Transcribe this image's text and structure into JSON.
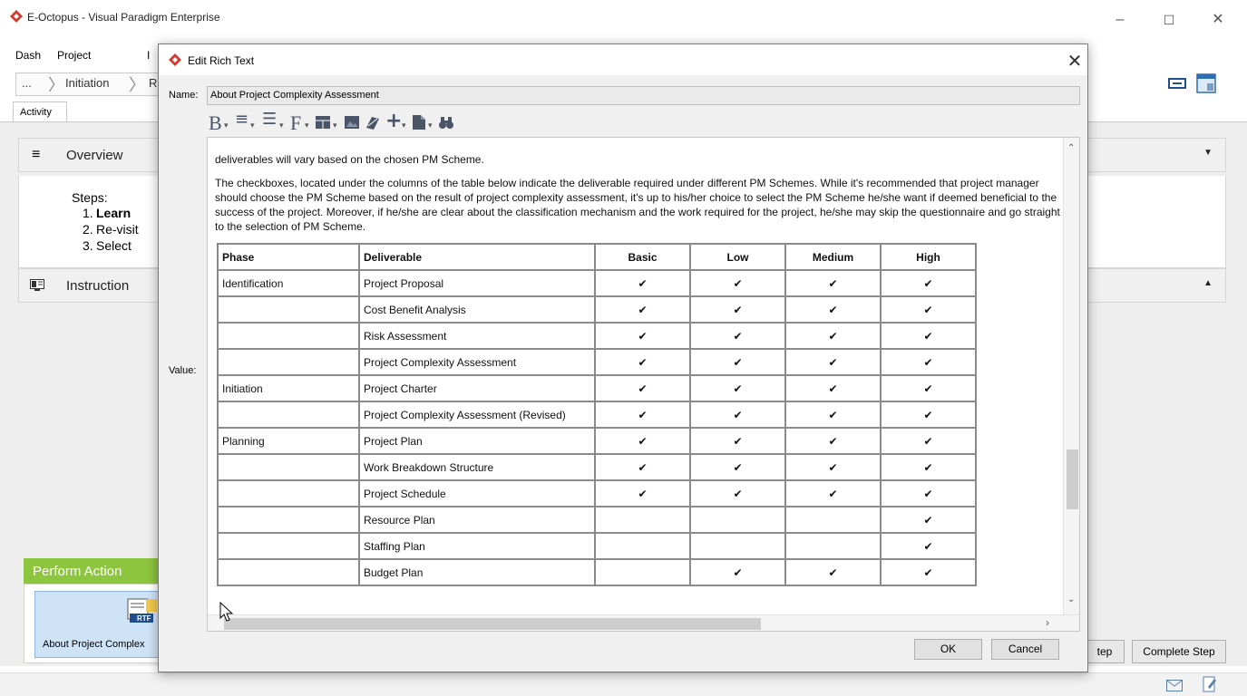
{
  "window": {
    "title": "E-Octopus - Visual Paradigm Enterprise",
    "controls": {
      "minimize": "–",
      "maximize": "☐",
      "close": "✕"
    }
  },
  "menu": [
    "Dash",
    "Project",
    "I"
  ],
  "breadcrumb": {
    "ellipsis": "...",
    "item1": "Initiation",
    "item2": "R"
  },
  "tabs": {
    "activity": "Activity"
  },
  "panels": {
    "overview": "Overview",
    "instruction": "Instruction",
    "steps_label": "Steps:",
    "steps": [
      {
        "num": "1.",
        "text": "Learn"
      },
      {
        "num": "2.",
        "text": "Re-visit"
      },
      {
        "num": "3.",
        "text": "Select"
      }
    ]
  },
  "perform_action": {
    "header": "Perform Action",
    "tile_label": "About Project Complex",
    "tile_icon_text": "RTF"
  },
  "bottom_buttons": {
    "step": "tep",
    "complete": "Complete Step"
  },
  "dialog": {
    "title": "Edit Rich Text",
    "close": "✕",
    "name_label": "Name:",
    "name_value": "About Project Complexity Assessment",
    "value_label": "Value:",
    "toolbar": {
      "bold": "B",
      "align": "≡",
      "list": "☰",
      "font": "F",
      "plus": "+",
      "find": "⛼"
    },
    "paragraphs": [
      "deliverables will vary based on the chosen PM Scheme.",
      "The checkboxes, located under the columns of the table below indicate the deliverable required under different PM Schemes. While it's recommended that project manager should choose the PM Scheme based on the result of project complexity assessment, it's up to his/her choice to select the PM Scheme he/she want if deemed beneficial to the success of the project. Moreover, if he/she are clear about the classification mechanism and the work required for the project, he/she may skip the questionnaire and go straight to the selection of PM Scheme."
    ],
    "table": {
      "headers": [
        "Phase",
        "Deliverable",
        "Basic",
        "Low",
        "Medium",
        "High"
      ],
      "check_glyph": "✔",
      "rows": [
        {
          "phase": "Identification",
          "deliverable": "Project Proposal",
          "basic": "✔",
          "low": "✔",
          "medium": "✔",
          "high": "✔"
        },
        {
          "phase": "",
          "deliverable": "Cost Benefit Analysis",
          "basic": "✔",
          "low": "✔",
          "medium": "✔",
          "high": "✔"
        },
        {
          "phase": "",
          "deliverable": "Risk Assessment",
          "basic": "✔",
          "low": "✔",
          "medium": "✔",
          "high": "✔"
        },
        {
          "phase": "",
          "deliverable": "Project Complexity Assessment",
          "basic": "✔",
          "low": "✔",
          "medium": "✔",
          "high": "✔"
        },
        {
          "phase": "Initiation",
          "deliverable": "Project Charter",
          "basic": "✔",
          "low": "✔",
          "medium": "✔",
          "high": "✔"
        },
        {
          "phase": "",
          "deliverable": "Project Complexity Assessment (Revised)",
          "basic": "✔",
          "low": "✔",
          "medium": "✔",
          "high": "✔"
        },
        {
          "phase": "Planning",
          "deliverable": "Project Plan",
          "basic": "✔",
          "low": "✔",
          "medium": "✔",
          "high": "✔"
        },
        {
          "phase": "",
          "deliverable": "Work Breakdown Structure",
          "basic": "✔",
          "low": "✔",
          "medium": "✔",
          "high": "✔"
        },
        {
          "phase": "",
          "deliverable": "Project Schedule",
          "basic": "✔",
          "low": "✔",
          "medium": "✔",
          "high": "✔"
        },
        {
          "phase": "",
          "deliverable": "Resource Plan",
          "basic": "",
          "low": "",
          "medium": "",
          "high": "✔"
        },
        {
          "phase": "",
          "deliverable": "Staffing Plan",
          "basic": "",
          "low": "",
          "medium": "",
          "high": "✔"
        },
        {
          "phase": "",
          "deliverable": "Budget Plan",
          "basic": "",
          "low": "✔",
          "medium": "✔",
          "high": "✔"
        }
      ]
    },
    "ok": "OK",
    "cancel": "Cancel"
  },
  "colors": {
    "brand": "#d43b2f",
    "perform_action": "#8dc53e",
    "tile": "#cfe3f7"
  }
}
